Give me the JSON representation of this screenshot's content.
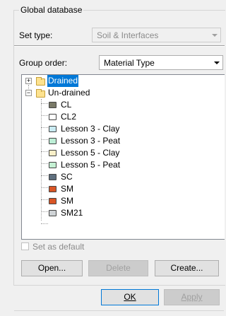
{
  "global_database": {
    "title": "Global database",
    "set_type_label": "Set type:",
    "set_type_value": "Soil & Interfaces",
    "group_order_label": "Group order:",
    "group_order_value": "Material Type"
  },
  "tree": {
    "groups": [
      {
        "label": "Drained",
        "expanded": false,
        "selected": true
      },
      {
        "label": "Un-drained",
        "expanded": true,
        "selected": false
      }
    ],
    "items": [
      {
        "label": "CL",
        "color": "#7a7a68"
      },
      {
        "label": "CL2",
        "color": "#ffffff"
      },
      {
        "label": "Lesson 3 - Clay",
        "color": "#c9ebf3"
      },
      {
        "label": "Lesson 3 - Peat",
        "color": "#bdeed6"
      },
      {
        "label": "Lesson 5 - Clay",
        "color": "#f9efc8"
      },
      {
        "label": "Lesson 5 - Peat",
        "color": "#c4f0d3"
      },
      {
        "label": "SC",
        "color": "#5f6f7e"
      },
      {
        "label": "SM",
        "color": "#d95525"
      },
      {
        "label": "SM",
        "color": "#d95525"
      },
      {
        "label": "SM21",
        "color": "#cfd3d6"
      }
    ]
  },
  "set_as_default_label": "Set as default",
  "buttons": {
    "open": "Open...",
    "delete": "Delete",
    "create": "Create...",
    "ok": "OK",
    "apply": "Apply"
  }
}
